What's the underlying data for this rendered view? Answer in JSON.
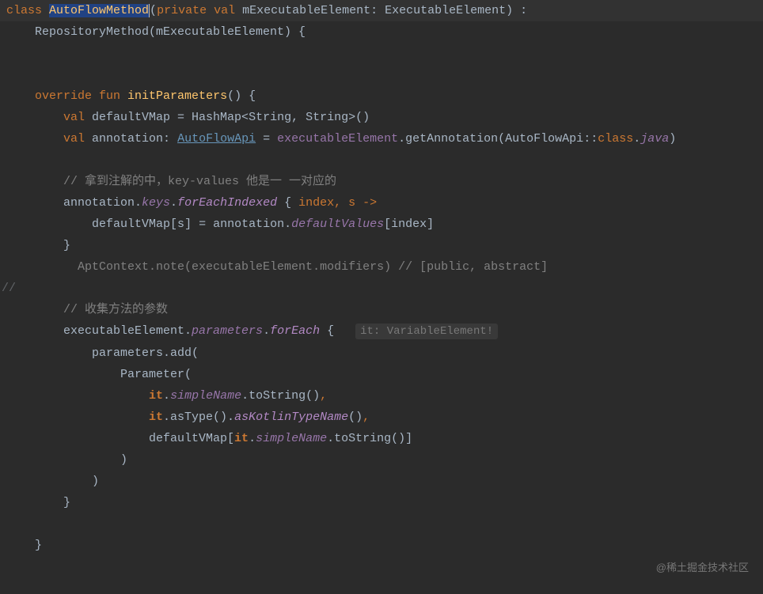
{
  "colors": {
    "bg": "#2b2b2b",
    "fg": "#a9b7c6",
    "keyword": "#cc7832",
    "function": "#ffc66d",
    "link": "#6897bb",
    "italic": "#9876aa",
    "comment": "#808080",
    "selection": "#214283"
  },
  "watermark": "@稀土掘金技术社区",
  "gutter_comment": "//",
  "code": {
    "l1_class": "class ",
    "l1_name": "AutoFlowMethod",
    "l1_paren": "(",
    "l1_private": "private ",
    "l1_val": "val ",
    "l1_param": "mExecutableElement: ExecutableElement) :",
    "l2": "    RepositoryMethod(mExecutableElement) {",
    "l5_override": "    override ",
    "l5_fun": "fun ",
    "l5_name": "initParameters",
    "l5_rest": "() {",
    "l6_val": "        val ",
    "l6_rest": "defaultVMap = HashMap<String, String>()",
    "l7_val": "        val ",
    "l7_ann": "annotation: ",
    "l7_link": "AutoFlowApi",
    "l7_eq": " = ",
    "l7_exec": "executableElement",
    "l7_dot": ".getAnnotation(",
    "l7_api": "AutoFlowApi",
    "l7_cc": "::",
    "l7_class": "class",
    "l7_dot2": ".",
    "l7_java": "java",
    "l7_close": ")",
    "l9_comment": "        // 拿到注解的中，key-values 他是一 一对应的",
    "l10a": "        annotation.",
    "l10_keys": "keys",
    "l10_dot": ".",
    "l10_fei": "forEachIndexed",
    "l10_open": " { ",
    "l10_idx": "index",
    "l10_c": ", ",
    "l10_s": "s",
    "l10_arrow": " ->",
    "l11a": "            defaultVMap[",
    "l11_s": "s",
    "l11b": "] = annotation.",
    "l11_dv": "defaultValues",
    "l11c": "[",
    "l11_idx": "index",
    "l11d": "]",
    "l12": "        }",
    "l13a": "          AptContext.note(executableElement.modifiers) // [public, abstract]",
    "l15_comment": "        // 收集方法的参数",
    "l16a": "        executableElement.",
    "l16_params": "parameters",
    "l16_dot": ".",
    "l16_fe": "forEach",
    "l16_open": " { ",
    "l16_hint": "it: VariableElement!",
    "l17a": "            parameters.add(",
    "l18a": "                Parameter(",
    "l19a": "                    ",
    "l19_it": "it",
    "l19_dot": ".",
    "l19_sn": "simpleName",
    "l19_rest": ".toString()",
    "l19_comma": ",",
    "l20a": "                    ",
    "l20_it": "it",
    "l20_rest": ".asType().",
    "l20_ak": "asKotlinTypeName",
    "l20_p": "()",
    "l20_comma": ",",
    "l21a": "                    defaultVMap[",
    "l21_it": "it",
    "l21_dot": ".",
    "l21_sn": "simpleName",
    "l21_rest": ".toString()]",
    "l22": "                )",
    "l23": "            )",
    "l24": "        }",
    "l26": "    }"
  }
}
